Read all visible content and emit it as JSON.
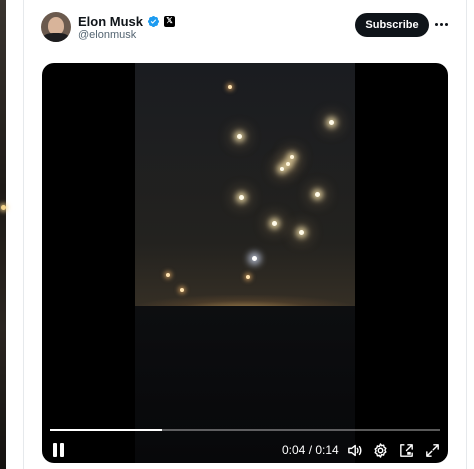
{
  "post": {
    "author_name": "Elon Musk",
    "author_handle": "@elonmusk",
    "verified": true,
    "affiliate_badge": "𝕏",
    "subscribe_label": "Subscribe"
  },
  "video": {
    "state": "playing",
    "current_time": "0:04",
    "duration": "0:14",
    "time_display": "0:04 / 0:14",
    "progress": 0.286,
    "controls": [
      "pause-icon",
      "volume-icon",
      "settings-gear-icon",
      "picture-in-picture-icon",
      "fullscreen-icon"
    ]
  },
  "colors": {
    "subscribe_bg": "#0f1419",
    "verified_blue": "#1d9bf0",
    "handle_gray": "#536471"
  }
}
